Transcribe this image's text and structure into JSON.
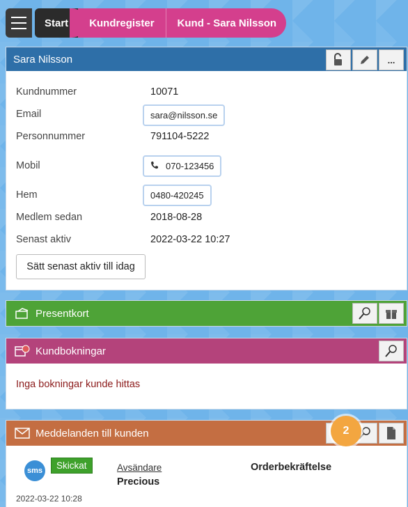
{
  "breadcrumb": {
    "start": "Start",
    "registry": "Kundregister",
    "current": "Kund - Sara Nilsson"
  },
  "customer": {
    "title": "Sara Nilsson",
    "fields": {
      "kundnummer_label": "Kundnummer",
      "kundnummer": "10071",
      "email_label": "Email",
      "email": "sara@nilsson.se",
      "personnummer_label": "Personnummer",
      "personnummer": "791104-5222",
      "mobil_label": "Mobil",
      "mobil": "070-123456",
      "hem_label": "Hem",
      "hem": "0480-420245",
      "medlem_label": "Medlem sedan",
      "medlem": "2018-08-28",
      "senast_label": "Senast aktiv",
      "senast": "2022-03-22 10:27"
    },
    "set_active_button": "Sätt senast aktiv till idag",
    "more_label": "..."
  },
  "giftcards": {
    "title": "Presentkort"
  },
  "bookings": {
    "title": "Kundbokningar",
    "empty_text": "Inga bokningar kunde hittas"
  },
  "messages": {
    "title": "Meddelanden till kunden",
    "notification_count": "2",
    "item": {
      "channel": "sms",
      "status": "Skickat",
      "sender_label": "Avsändare",
      "sender": "Precious",
      "subject": "Orderbekräftelse",
      "date": "2022-03-22 10:28"
    }
  },
  "colors": {
    "customer_header": "#2e6fa8",
    "giftcard_header": "#4ea337",
    "bookings_header": "#b4437b",
    "messages_header": "#c46e42",
    "breadcrumb_accent": "#d43f8d",
    "badge": "#f3a640"
  }
}
